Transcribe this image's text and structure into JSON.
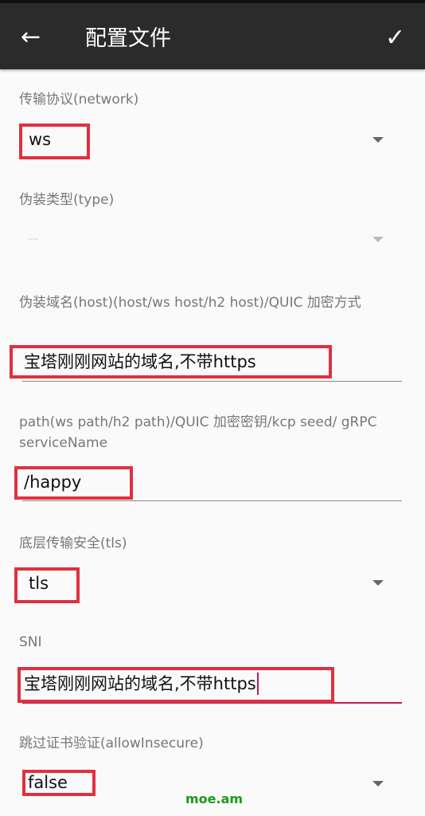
{
  "header": {
    "title": "配置文件",
    "back_icon": "arrow-left-icon",
    "save_icon": "check-icon"
  },
  "fields": [
    {
      "label": "传输协议(network)",
      "value": "ws",
      "type": "select"
    },
    {
      "label": "伪装类型(type)",
      "value": "---",
      "type": "select",
      "disabled": true
    },
    {
      "label": "伪装域名(host)(host/ws host/h2 host)/QUIC 加密方式",
      "value": "宝塔刚刚网站的域名,不带https",
      "type": "text"
    },
    {
      "label": "path(ws path/h2 path)/QUIC 加密密钥/kcp seed/ gRPC serviceName",
      "value": "/happy",
      "type": "text"
    },
    {
      "label": "底层传输安全(tls)",
      "value": "tls",
      "type": "select"
    },
    {
      "label": "SNI",
      "value": "宝塔刚刚网站的域名,不带https",
      "type": "text",
      "focused": true
    },
    {
      "label": "跳过证书验证(allowInsecure)",
      "value": "false",
      "type": "select"
    }
  ],
  "watermark": "moe.am",
  "colors": {
    "highlight": "#e03040",
    "focus": "#c2185b",
    "watermark": "#1a9a1a"
  }
}
